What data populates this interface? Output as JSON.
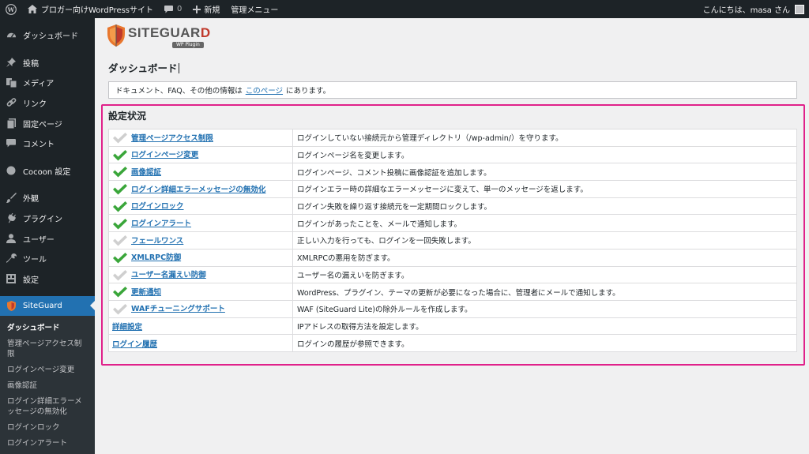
{
  "admin_bar": {
    "site_name": "ブロガー向けWordPressサイト",
    "comments_count": "0",
    "new_label": "新規",
    "admin_menu_label": "管理メニュー",
    "greeting": "こんにちは、masa さん"
  },
  "sidebar": {
    "menu": [
      {
        "label": "ダッシュボード",
        "icon": "dashboard-icon"
      },
      {
        "label": "投稿",
        "icon": "pin-icon"
      },
      {
        "label": "メディア",
        "icon": "media-icon"
      },
      {
        "label": "リンク",
        "icon": "link-icon"
      },
      {
        "label": "固定ページ",
        "icon": "page-icon"
      },
      {
        "label": "コメント",
        "icon": "comment-icon"
      },
      {
        "label": "Cocoon 設定",
        "icon": "cocoon-icon"
      },
      {
        "label": "外観",
        "icon": "brush-icon"
      },
      {
        "label": "プラグイン",
        "icon": "plugin-icon"
      },
      {
        "label": "ユーザー",
        "icon": "user-icon"
      },
      {
        "label": "ツール",
        "icon": "wrench-icon"
      },
      {
        "label": "設定",
        "icon": "settings-icon"
      },
      {
        "label": "SiteGuard",
        "icon": "siteguard-icon"
      }
    ],
    "submenu": [
      "ダッシュボード",
      "管理ページアクセス制限",
      "ログインページ変更",
      "画像認証",
      "ログイン詳細エラーメッセージの無効化",
      "ログインロック",
      "ログインアラート"
    ]
  },
  "logo": {
    "text_main": "SITEGUAR",
    "text_accent": "D",
    "text_sub": "WP Plugin"
  },
  "page": {
    "title": "ダッシュボード",
    "notice_before": "ドキュメント、FAQ、その他の情報は",
    "notice_link": "このページ",
    "notice_after": "にあります。",
    "section_title": "設定状況"
  },
  "status_rows": [
    {
      "name": "管理ページアクセス制限",
      "description": "ログインしていない接続元から管理ディレクトリ（/wp-admin/）を守ります。",
      "enabled": false,
      "has_check": true
    },
    {
      "name": "ログインページ変更",
      "description": "ログインページ名を変更します。",
      "enabled": true,
      "has_check": true
    },
    {
      "name": "画像認証",
      "description": "ログインページ、コメント投稿に画像認証を追加します。",
      "enabled": true,
      "has_check": true
    },
    {
      "name": "ログイン詳細エラーメッセージの無効化",
      "description": "ログインエラー時の詳細なエラーメッセージに変えて、単一のメッセージを返します。",
      "enabled": true,
      "has_check": true
    },
    {
      "name": "ログインロック",
      "description": "ログイン失敗を繰り返す接続元を一定期間ロックします。",
      "enabled": true,
      "has_check": true
    },
    {
      "name": "ログインアラート",
      "description": "ログインがあったことを、メールで通知します。",
      "enabled": true,
      "has_check": true
    },
    {
      "name": "フェールワンス",
      "description": "正しい入力を行っても、ログインを一回失敗します。",
      "enabled": false,
      "has_check": true
    },
    {
      "name": "XMLRPC防御",
      "description": "XMLRPCの悪用を防ぎます。",
      "enabled": true,
      "has_check": true
    },
    {
      "name": "ユーザー名漏えい防御",
      "description": "ユーザー名の漏えいを防ぎます。",
      "enabled": false,
      "has_check": true
    },
    {
      "name": "更新通知",
      "description": "WordPress、プラグイン、テーマの更新が必要になった場合に、管理者にメールで通知します。",
      "enabled": true,
      "has_check": true
    },
    {
      "name": "WAFチューニングサポート",
      "description": "WAF (SiteGuard Lite)の除外ルールを作成します。",
      "enabled": false,
      "has_check": true
    },
    {
      "name": "詳細設定",
      "description": "IPアドレスの取得方法を設定します。",
      "enabled": false,
      "has_check": false
    },
    {
      "name": "ログイン履歴",
      "description": "ログインの履歴が参照できます。",
      "enabled": false,
      "has_check": false
    }
  ],
  "colors": {
    "check_on": "#3aa63a",
    "check_off": "#cfcfcf",
    "highlight": "#e0218a",
    "link": "#2271b1"
  }
}
